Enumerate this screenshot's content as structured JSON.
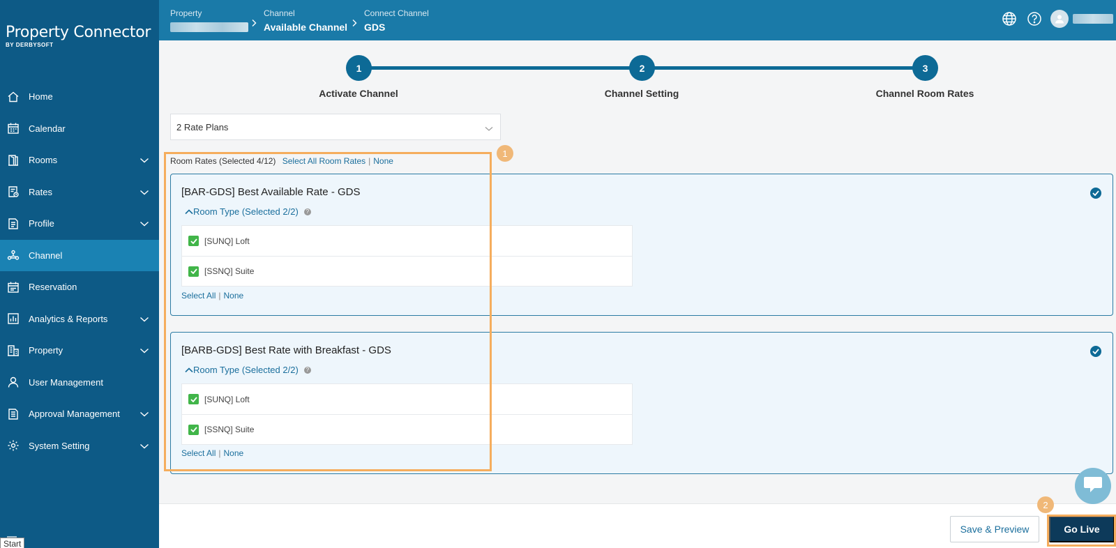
{
  "logo": {
    "title": "Property Connector",
    "subtitle": "BY DERBYSOFT"
  },
  "sidebar": {
    "items": [
      {
        "label": "Home",
        "icon": "home-icon",
        "expandable": false
      },
      {
        "label": "Calendar",
        "icon": "calendar-icon",
        "expandable": false
      },
      {
        "label": "Rooms",
        "icon": "door-icon",
        "expandable": true
      },
      {
        "label": "Rates",
        "icon": "rates-icon",
        "expandable": true
      },
      {
        "label": "Profile",
        "icon": "document-icon",
        "expandable": true
      },
      {
        "label": "Channel",
        "icon": "channel-icon",
        "expandable": false,
        "active": true
      },
      {
        "label": "Reservation",
        "icon": "reservation-icon",
        "expandable": false
      },
      {
        "label": "Analytics & Reports",
        "icon": "chart-icon",
        "expandable": true
      },
      {
        "label": "Property",
        "icon": "building-icon",
        "expandable": true
      },
      {
        "label": "User Management",
        "icon": "user-icon",
        "expandable": false
      },
      {
        "label": "Approval Management",
        "icon": "approval-icon",
        "expandable": true
      },
      {
        "label": "System Setting",
        "icon": "gear-icon",
        "expandable": true
      }
    ],
    "start_tooltip": "Start"
  },
  "breadcrumb": {
    "property": {
      "top": "Property"
    },
    "channel": {
      "top": "Channel",
      "bottom": "Available Channel"
    },
    "connect": {
      "top": "Connect Channel",
      "bottom": "GDS"
    }
  },
  "steps": [
    {
      "number": "1",
      "label": "Activate Channel"
    },
    {
      "number": "2",
      "label": "Channel Setting"
    },
    {
      "number": "3",
      "label": "Channel Room Rates"
    }
  ],
  "rate_plan_select": {
    "value": "2 Rate Plans"
  },
  "room_rates": {
    "label": "Room Rates (Selected 4/12)",
    "select_all": "Select All Room Rates",
    "none": "None"
  },
  "rate_plans": [
    {
      "title": "[BAR-GDS] Best Available Rate - GDS",
      "room_type_label": "Room Type (Selected 2/2)",
      "rooms": [
        "[SUNQ] Loft",
        "[SSNQ] Suite"
      ],
      "select_all": "Select All",
      "none": "None"
    },
    {
      "title": "[BARB-GDS] Best Rate with Breakfast - GDS",
      "room_type_label": "Room Type (Selected 2/2)",
      "rooms": [
        "[SUNQ] Loft",
        "[SSNQ] Suite"
      ],
      "select_all": "Select All",
      "none": "None"
    }
  ],
  "annotations": {
    "badge1": "1",
    "badge2": "2"
  },
  "footer": {
    "save_preview": "Save & Preview",
    "go_live": "Go Live"
  },
  "colors": {
    "sidebar": "#0d5a86",
    "header": "#1a7aa8",
    "active": "#1a82b3",
    "accent": "#0d6a96",
    "highlight": "#f5ad5d",
    "check": "#41b549"
  }
}
